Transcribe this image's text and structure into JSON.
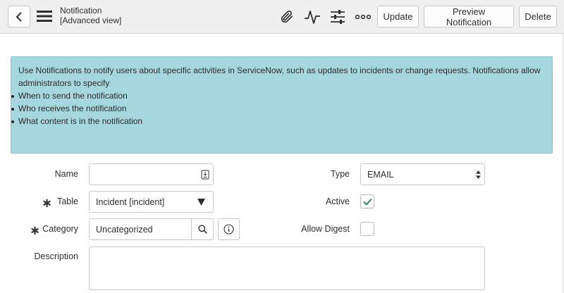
{
  "header": {
    "title_line1": "Notification",
    "title_line2": "[Advanced view]",
    "buttons": {
      "update": "Update",
      "preview": "Preview Notification",
      "delete": "Delete"
    },
    "icons": [
      "back-icon",
      "hamburger-menu-icon",
      "paperclip-icon",
      "activity-icon",
      "sliders-icon",
      "more-options-icon"
    ]
  },
  "info": {
    "intro": "Use Notifications to notify users about specific activities in ServiceNow, such as updates to incidents or change requests. Notifications allow administrators to specify",
    "items": [
      "When to send the notification",
      "Who receives the notification",
      "What content is in the notification"
    ]
  },
  "form": {
    "name": {
      "label": "Name",
      "value": ""
    },
    "table": {
      "label": "Table",
      "value": "Incident [incident]"
    },
    "category": {
      "label": "Category",
      "value": "Uncategorized"
    },
    "description": {
      "label": "Description",
      "value": ""
    },
    "type": {
      "label": "Type",
      "value": "EMAIL"
    },
    "active": {
      "label": "Active",
      "checked": true
    },
    "allow_digest": {
      "label": "Allow Digest",
      "checked": false
    },
    "required_marker": "∗"
  },
  "colors": {
    "info_bg": "#a6d7df",
    "check_green": "#2e7d6b"
  }
}
